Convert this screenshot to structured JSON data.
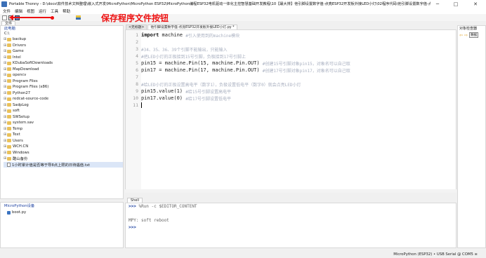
{
  "window": {
    "title": "Portable Thonny  -  D:\\docs\\软件技术文档整理\\嵌入式开发\\MicroPython\\MicroPython ESP32\\MicroPython编程ESP32电机驱动一体化主控智慧基础开发教程\\10【最大排】他引脚设置数字值-点亮ESP32开发板外接LED小灯\\02程序代码\\他引脚设置数字值-点亮E...  @  2:7",
    "minimize": "─",
    "maximize": "□",
    "close": "✕"
  },
  "menu": [
    "文件",
    "编辑",
    "视图",
    "运行",
    "工具",
    "帮助"
  ],
  "annotation": {
    "text": "保存程序文件按钮",
    "color": "#ee1111"
  },
  "files_panel": {
    "tab_label": "文件",
    "computer_label": "此电脑",
    "path": "C:\\",
    "items": [
      {
        "name": "backup",
        "type": "folder"
      },
      {
        "name": "Drivers",
        "type": "folder"
      },
      {
        "name": "Game",
        "type": "folder"
      },
      {
        "name": "Intel",
        "type": "folder"
      },
      {
        "name": "KDubaSoftDownloads",
        "type": "folder"
      },
      {
        "name": "MapDownload",
        "type": "folder"
      },
      {
        "name": "opencv",
        "type": "folder"
      },
      {
        "name": "Program Files",
        "type": "folder"
      },
      {
        "name": "Program Files (x86)",
        "type": "folder"
      },
      {
        "name": "Python27",
        "type": "folder"
      },
      {
        "name": "redcat-source-code",
        "type": "folder"
      },
      {
        "name": "SadpLog",
        "type": "folder"
      },
      {
        "name": "soft",
        "type": "folder"
      },
      {
        "name": "SWSetup",
        "type": "folder"
      },
      {
        "name": "system.sav",
        "type": "folder"
      },
      {
        "name": "Temp",
        "type": "folder"
      },
      {
        "name": "Text",
        "type": "folder"
      },
      {
        "name": "Users",
        "type": "folder"
      },
      {
        "name": "WCH.CN",
        "type": "folder"
      },
      {
        "name": "Windows",
        "type": "folder"
      },
      {
        "name": "酷山备份",
        "type": "folder"
      },
      {
        "name": "1小时累计值是否等于导8点上限的日待遇值.txt",
        "type": "file"
      }
    ]
  },
  "micropython_panel": {
    "title": "MicroPython设备",
    "items": [
      {
        "name": "boot.py"
      }
    ]
  },
  "editor": {
    "tabs": [
      {
        "label": "<无标题>"
      },
      {
        "label": "他引脚设置数字值-点亮ESP32开发板外接LED小灯.py *"
      }
    ],
    "lines": [
      {
        "n": "1",
        "segments": [
          {
            "t": "import",
            "c": "kw"
          },
          {
            "t": " machine ",
            "c": ""
          },
          {
            "t": "#引入使用到的machine模块",
            "c": "cm"
          }
        ]
      },
      {
        "n": "2",
        "segments": []
      },
      {
        "n": "3",
        "segments": [
          {
            "t": "#34、35、36、39个引脚不能输出，只能输入",
            "c": "cm"
          }
        ]
      },
      {
        "n": "4",
        "segments": [
          {
            "t": "#把LED小灯的正极接到15号引脚，负极接到17号引脚上",
            "c": "cm"
          }
        ]
      },
      {
        "n": "5",
        "segments": [
          {
            "t": "pin15 = machine.Pin(15, machine.Pin.OUT) ",
            "c": ""
          },
          {
            "t": "#创建15号引脚对象pin15，对象名可以自己取",
            "c": "cm"
          }
        ]
      },
      {
        "n": "6",
        "segments": [
          {
            "t": "pin17 = machine.Pin(17, machine.Pin.OUT) ",
            "c": ""
          },
          {
            "t": "#创建17号引脚对象pin17，对象名可以自己取",
            "c": "cm"
          }
        ]
      },
      {
        "n": "7",
        "segments": []
      },
      {
        "n": "8",
        "segments": [
          {
            "t": "#给LED小灯的正极设置高电平（数字1），负极设置低电平（数字0）就会点亮LED小灯",
            "c": "cm"
          }
        ]
      },
      {
        "n": "9",
        "segments": [
          {
            "t": "pin15.value(1) ",
            "c": ""
          },
          {
            "t": "#给15号引脚设置高电平",
            "c": "cm"
          }
        ]
      },
      {
        "n": "10",
        "segments": [
          {
            "t": "pin17.value(0) ",
            "c": ""
          },
          {
            "t": "#给17号引脚设置低电平",
            "c": "cm"
          }
        ]
      },
      {
        "n": "11",
        "segments": [
          {
            "t": "",
            "c": "cursor"
          }
        ]
      }
    ]
  },
  "shell": {
    "tab_label": "Shell",
    "lines": [
      {
        "prompt": ">>>",
        "text": " %Run -c $EDITOR_CONTENT"
      },
      {
        "prompt": "",
        "text": ""
      },
      {
        "prompt": "",
        "text": "MPY: soft reboot"
      },
      {
        "prompt": ">>>",
        "text": ""
      }
    ]
  },
  "object_inspector": {
    "title": "对象检查器",
    "nav_back": "⇦",
    "nav_forward": "⇨",
    "data_button": "数据"
  },
  "status": {
    "text": "MicroPython (ESP32) • USB Serial @ COM5  ≡"
  }
}
